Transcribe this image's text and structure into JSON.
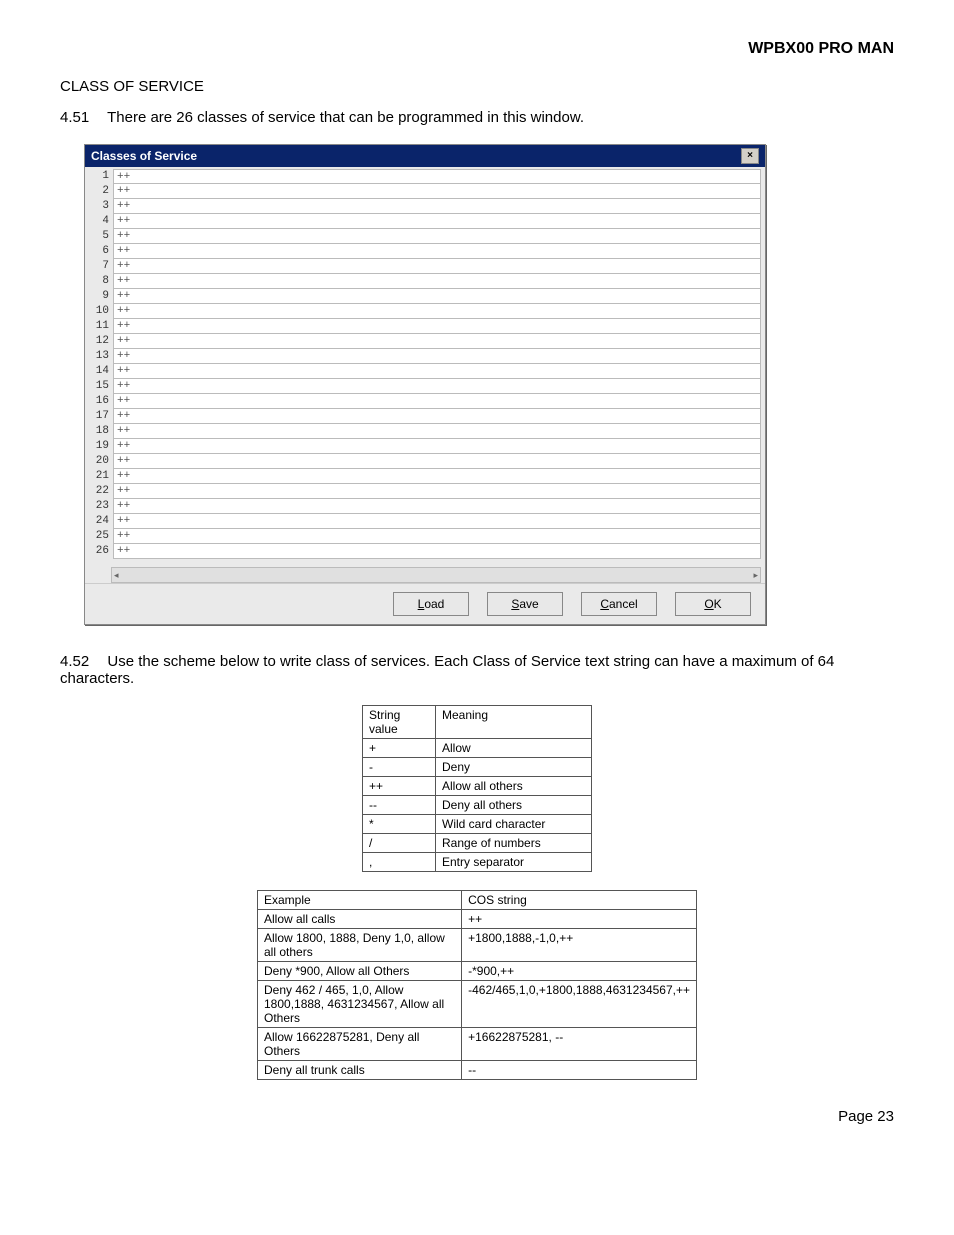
{
  "header": {
    "title": "WPBX00 PRO MAN"
  },
  "section": {
    "title": "CLASS OF SERVICE"
  },
  "paragraphs": {
    "p451_num": "4.51",
    "p451_text": "There are 26 classes of service that can be programmed in this window.",
    "p452_num": "4.52",
    "p452_text": "Use the scheme below to write class of services.  Each Class of Service text string can have a maximum of 64 characters."
  },
  "dialog": {
    "title": "Classes of Service",
    "close_label": "×",
    "rows": [
      {
        "idx": "1",
        "val": "++"
      },
      {
        "idx": "2",
        "val": "++"
      },
      {
        "idx": "3",
        "val": "++"
      },
      {
        "idx": "4",
        "val": "++"
      },
      {
        "idx": "5",
        "val": "++"
      },
      {
        "idx": "6",
        "val": "++"
      },
      {
        "idx": "7",
        "val": "++"
      },
      {
        "idx": "8",
        "val": "++"
      },
      {
        "idx": "9",
        "val": "++"
      },
      {
        "idx": "10",
        "val": "++"
      },
      {
        "idx": "11",
        "val": "++"
      },
      {
        "idx": "12",
        "val": "++"
      },
      {
        "idx": "13",
        "val": "++"
      },
      {
        "idx": "14",
        "val": "++"
      },
      {
        "idx": "15",
        "val": "++"
      },
      {
        "idx": "16",
        "val": "++"
      },
      {
        "idx": "17",
        "val": "++"
      },
      {
        "idx": "18",
        "val": "++"
      },
      {
        "idx": "19",
        "val": "++"
      },
      {
        "idx": "20",
        "val": "++"
      },
      {
        "idx": "21",
        "val": "++"
      },
      {
        "idx": "22",
        "val": "++"
      },
      {
        "idx": "23",
        "val": "++"
      },
      {
        "idx": "24",
        "val": "++"
      },
      {
        "idx": "25",
        "val": "++"
      },
      {
        "idx": "26",
        "val": "++"
      }
    ],
    "buttons": {
      "load": "Load",
      "save": "Save",
      "cancel": "Cancel",
      "ok_u": "O",
      "ok_rest": "K"
    },
    "scroll_left": "◂",
    "scroll_right": "▸"
  },
  "string_table": {
    "headers": [
      "String value",
      "Meaning"
    ],
    "rows": [
      [
        "+",
        "Allow"
      ],
      [
        "-",
        "Deny"
      ],
      [
        "++",
        "Allow all others"
      ],
      [
        "--",
        "Deny all others"
      ],
      [
        "*",
        "Wild card character"
      ],
      [
        "/",
        "Range of numbers"
      ],
      [
        ",",
        "Entry separator"
      ]
    ]
  },
  "example_table": {
    "headers": [
      "Example",
      "COS string"
    ],
    "rows": [
      [
        "Allow all calls",
        "++"
      ],
      [
        "Allow 1800, 1888, Deny 1,0, allow all others",
        "+1800,1888,-1,0,++"
      ],
      [
        "Deny *900, Allow all Others",
        "-*900,++"
      ],
      [
        "Deny 462 / 465, 1,0, Allow 1800,1888, 4631234567, Allow all Others",
        "-462/465,1,0,+1800,1888,4631234567,++"
      ],
      [
        "Allow 16622875281, Deny all Others",
        "+16622875281, --"
      ],
      [
        "Deny all trunk calls",
        "--"
      ]
    ]
  },
  "footer": {
    "page": "Page 23"
  }
}
